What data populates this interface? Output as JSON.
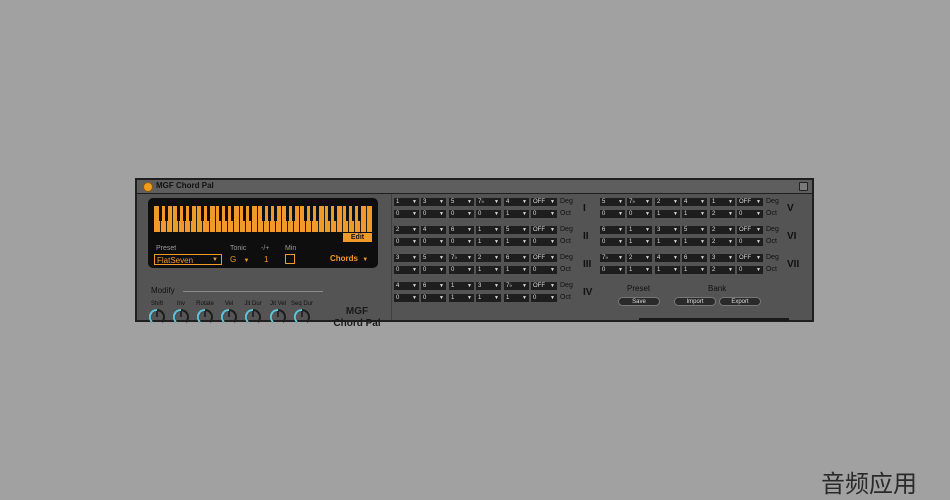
{
  "title": "MGF Chord Pal",
  "keyboard": {
    "edit_label": "Edit"
  },
  "labels": {
    "preset": "Preset",
    "tonic": "Tonic",
    "octave": "-/+",
    "min": "Min"
  },
  "values": {
    "preset": "FlatSeven",
    "tonic": "G",
    "octave": "1",
    "mode": "Chords"
  },
  "modify": {
    "label": "Modify",
    "knobs": [
      "Shift",
      "Inv",
      "Rotate",
      "Vel",
      "Jit Dur",
      "Jit Vel",
      "Seq Dur"
    ]
  },
  "brand": {
    "line1": "MGF",
    "line2": "Chord Pal"
  },
  "row_tags": {
    "deg": "Deg",
    "oct": "Oct"
  },
  "chords_left": [
    {
      "roman": "I",
      "deg": [
        "1",
        "3",
        "5",
        "7♭",
        "4",
        "OFF"
      ],
      "oct": [
        "0",
        "0",
        "0",
        "0",
        "1",
        "0"
      ]
    },
    {
      "roman": "II",
      "deg": [
        "2",
        "4",
        "6",
        "1",
        "5",
        "OFF"
      ],
      "oct": [
        "0",
        "0",
        "0",
        "1",
        "1",
        "0"
      ]
    },
    {
      "roman": "III",
      "deg": [
        "3",
        "5",
        "7♭",
        "2",
        "6",
        "OFF"
      ],
      "oct": [
        "0",
        "0",
        "0",
        "1",
        "1",
        "0"
      ]
    },
    {
      "roman": "IV",
      "deg": [
        "4",
        "6",
        "1",
        "3",
        "7♭",
        "OFF"
      ],
      "oct": [
        "0",
        "0",
        "1",
        "1",
        "1",
        "0"
      ]
    }
  ],
  "chords_right": [
    {
      "roman": "V",
      "deg": [
        "5",
        "7♭",
        "2",
        "4",
        "1",
        "OFF"
      ],
      "oct": [
        "0",
        "0",
        "1",
        "1",
        "2",
        "0"
      ]
    },
    {
      "roman": "VI",
      "deg": [
        "6",
        "1",
        "3",
        "5",
        "2",
        "OFF"
      ],
      "oct": [
        "0",
        "1",
        "1",
        "1",
        "2",
        "0"
      ]
    },
    {
      "roman": "VII",
      "deg": [
        "7♭",
        "2",
        "4",
        "6",
        "3",
        "OFF"
      ],
      "oct": [
        "0",
        "1",
        "1",
        "1",
        "2",
        "0"
      ]
    }
  ],
  "preset_section": {
    "label": "Preset",
    "save": "Save"
  },
  "bank_section": {
    "label": "Bank",
    "import": "Import",
    "export": "Export"
  },
  "watermark": "音频应用",
  "colors": {
    "accent": "#f09a2b",
    "knob_ring": "#5ec8d8",
    "panel_bg": "#545454"
  }
}
